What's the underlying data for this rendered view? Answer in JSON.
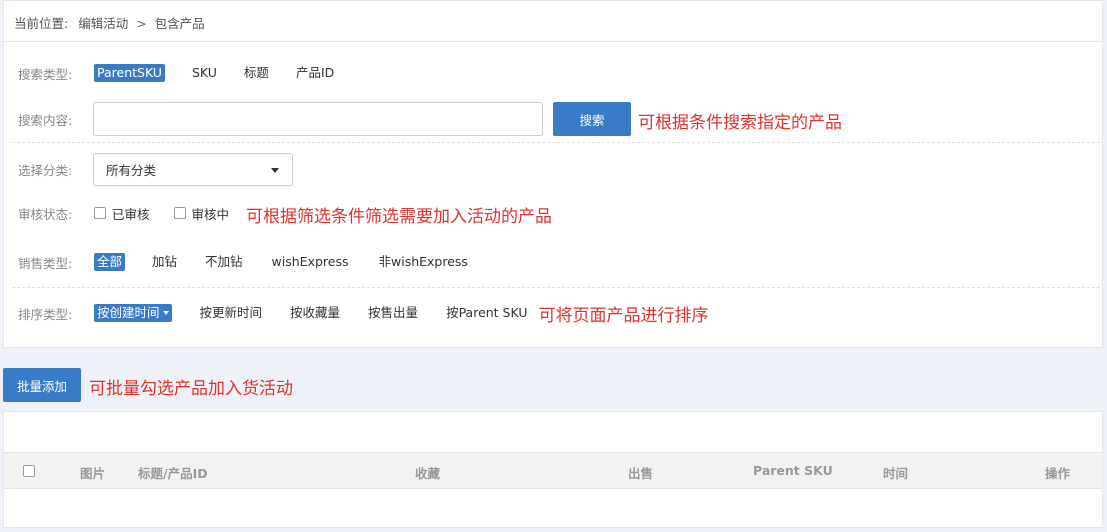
{
  "breadcrumb": {
    "prefix": "当前位置:",
    "parent": "编辑活动",
    "separator": ">",
    "current": "包含产品"
  },
  "search_type": {
    "label": "搜索类型:",
    "options": [
      "ParentSKU",
      "SKU",
      "标题",
      "产品ID"
    ],
    "active_index": 0
  },
  "search_content": {
    "label": "搜索内容:",
    "value": "",
    "placeholder": "",
    "button": "搜索"
  },
  "category": {
    "label": "选择分类:",
    "selected": "所有分类"
  },
  "review": {
    "label": "审核状态:",
    "options": [
      {
        "label": "已审核",
        "checked": false
      },
      {
        "label": "审核中",
        "checked": false
      }
    ]
  },
  "sale_type": {
    "label": "销售类型:",
    "options": [
      "全部",
      "加钻",
      "不加钻",
      "wishExpress",
      "非wishExpress"
    ],
    "active_index": 0
  },
  "sort_type": {
    "label": "排序类型:",
    "options": [
      "按创建时间",
      "按更新时间",
      "按收藏量",
      "按售出量",
      "按Parent SKU"
    ],
    "active_index": 0
  },
  "notes": {
    "search": "可根据条件搜索指定的产品",
    "filter": "可根据筛选条件筛选需要加入活动的产品",
    "sort": "可将页面产品进行排序",
    "batch": "可批量勾选产品加入货活动"
  },
  "batch_button": "批量添加",
  "table": {
    "columns": [
      "图片",
      "标题/产品ID",
      "收藏",
      "出售",
      "Parent SKU",
      "时间",
      "操作"
    ],
    "rows": []
  },
  "colors": {
    "accent": "#3a7bc8",
    "note": "#e0332f"
  }
}
